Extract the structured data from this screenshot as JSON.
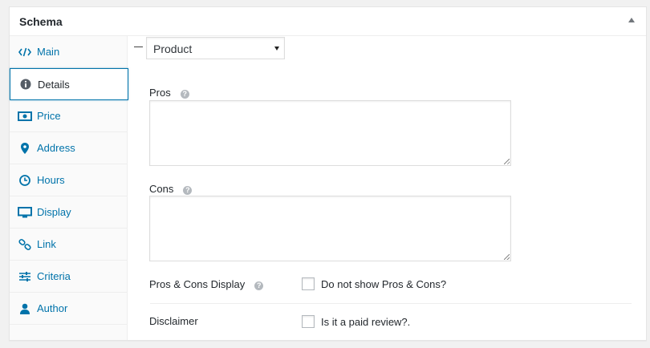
{
  "metabox": {
    "title": "Schema"
  },
  "tabs": [
    {
      "label": "Main",
      "icon": "code-icon"
    },
    {
      "label": "Details",
      "icon": "info-icon",
      "active": true
    },
    {
      "label": "Price",
      "icon": "money-icon"
    },
    {
      "label": "Address",
      "icon": "map-marker-icon"
    },
    {
      "label": "Hours",
      "icon": "clock-icon"
    },
    {
      "label": "Display",
      "icon": "monitor-icon"
    },
    {
      "label": "Link",
      "icon": "link-icon"
    },
    {
      "label": "Criteria",
      "icon": "sliders-icon"
    },
    {
      "label": "Author",
      "icon": "user-icon"
    }
  ],
  "details": {
    "schema_type": {
      "value": "Product"
    },
    "pros": {
      "label": "Pros",
      "value": ""
    },
    "cons": {
      "label": "Cons",
      "value": ""
    },
    "pros_cons_display": {
      "label": "Pros & Cons Display",
      "checkbox_label": "Do not show Pros & Cons?",
      "checked": false
    },
    "disclaimer": {
      "label": "Disclaimer",
      "checkbox_label": "Is it a paid review?.",
      "checked": false
    },
    "help_glyph": "?"
  },
  "colors": {
    "accent": "#0073aa",
    "text": "#23282d",
    "border": "#dddddd"
  }
}
